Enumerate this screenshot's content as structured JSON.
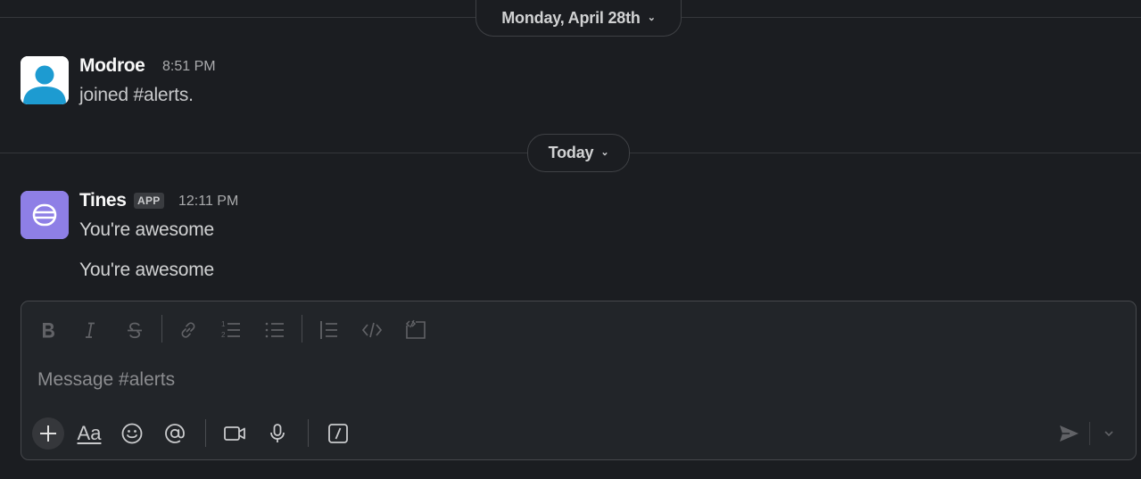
{
  "history": {
    "date_separators": [
      {
        "label": "Monday, April 28th"
      },
      {
        "label": "Today"
      }
    ]
  },
  "messages": [
    {
      "author": "Modroe",
      "time": "8:51 PM",
      "lines": [
        "joined #alerts."
      ],
      "avatar": "default-user-avatar",
      "avatar_color": "#1d9bd1"
    },
    {
      "author": "Tines",
      "badge": "APP",
      "time": "12:11 PM",
      "lines": [
        "You're awesome",
        "You're awesome"
      ],
      "avatar": "tines-logo",
      "avatar_color": "#8e7fe6"
    }
  ],
  "composer": {
    "placeholder": "Message #alerts",
    "formatting_toolbar": [
      "bold-icon",
      "italic-icon",
      "strikethrough-icon",
      "link-icon",
      "ordered-list-icon",
      "bulleted-list-icon",
      "blockquote-icon",
      "code-icon",
      "code-block-icon"
    ],
    "action_toolbar": [
      "plus-icon",
      "text-formatting-icon",
      "emoji-icon",
      "mention-icon",
      "video-icon",
      "microphone-icon",
      "slash-command-icon",
      "send-icon",
      "chevron-down-icon"
    ],
    "format_label": "Aa"
  },
  "colors": {
    "background": "#1b1d21",
    "composer_background": "#222529",
    "divider": "#35373b",
    "text": "#d1d2d3",
    "muted": "#aaabad"
  }
}
